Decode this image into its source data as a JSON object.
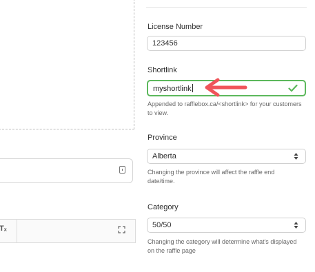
{
  "license": {
    "label": "License Number",
    "value": "123456"
  },
  "shortlink": {
    "label": "Shortlink",
    "value": "myshortlink",
    "help": "Appended to rafflebox.ca/<shortlink> for your customers to view."
  },
  "province": {
    "label": "Province",
    "value": "Alberta",
    "help": "Changing the province will affect the raffle end date/time."
  },
  "category": {
    "label": "Category",
    "value": "50/50",
    "help": "Changing the category will determine what's displayed on the raffle page"
  },
  "editor": {
    "clear_format_glyph": "Tₓ"
  },
  "colors": {
    "valid": "#5cb85c",
    "annotation_arrow": "#f0545a"
  }
}
